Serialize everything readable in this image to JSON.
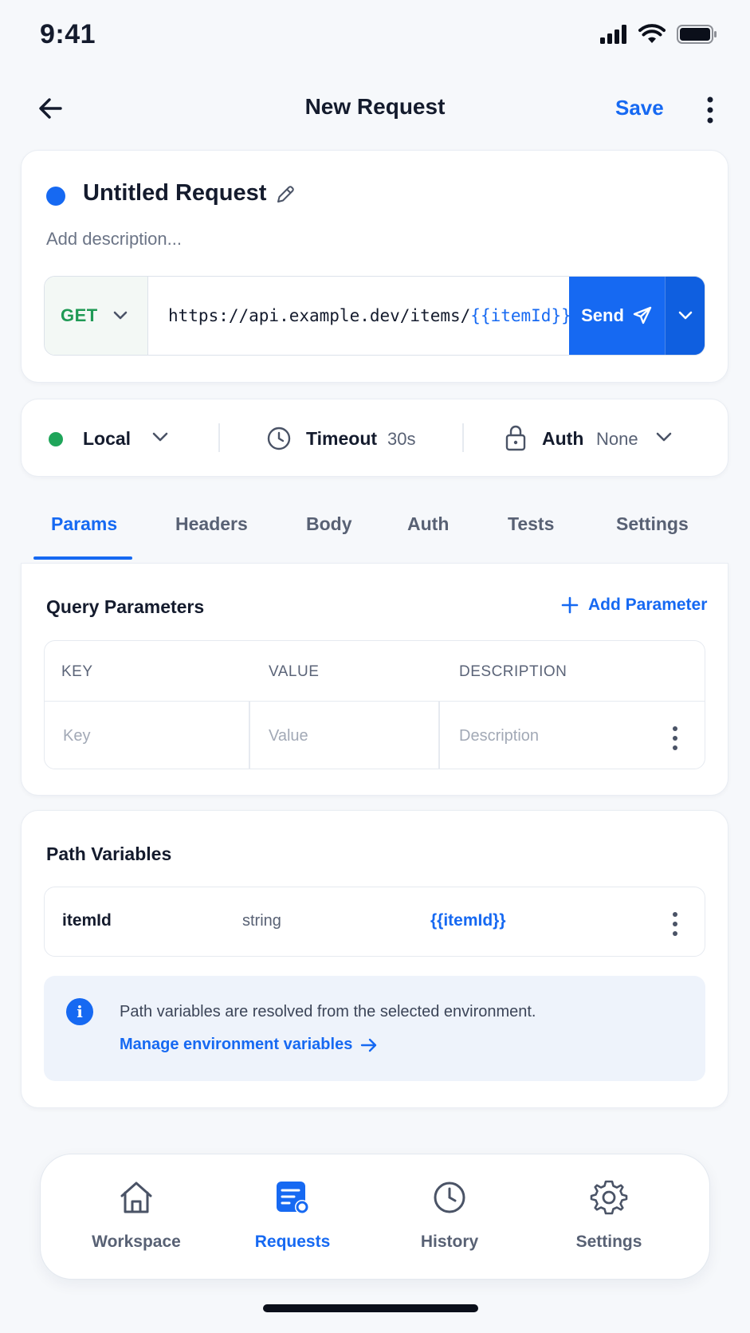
{
  "status_bar": {
    "time": "9:41"
  },
  "nav": {
    "title": "New Request",
    "save_label": "Save"
  },
  "request": {
    "name": "Untitled Request",
    "description_placeholder": "Add description...",
    "method": "GET",
    "url_base": "https://api.example.dev/items/",
    "url_variable": "{{itemId}}",
    "send_label": "Send"
  },
  "environment": {
    "name": "Local",
    "timeout_label": "Timeout",
    "timeout_value": "30s",
    "auth_label": "Auth",
    "auth_value": "None"
  },
  "tabs": [
    {
      "label": "Params",
      "active": true
    },
    {
      "label": "Headers",
      "active": false
    },
    {
      "label": "Body",
      "active": false
    },
    {
      "label": "Auth",
      "active": false
    },
    {
      "label": "Tests",
      "active": false
    },
    {
      "label": "Settings",
      "active": false
    }
  ],
  "query_params": {
    "title": "Query Parameters",
    "add_label": "Add Parameter",
    "columns": [
      "KEY",
      "VALUE",
      "DESCRIPTION"
    ],
    "placeholders": [
      "Key",
      "Value",
      "Description"
    ]
  },
  "path_variables": {
    "title": "Path Variables",
    "rows": [
      {
        "key": "itemId",
        "type": "string",
        "value": "{{itemId}}"
      }
    ],
    "info_text": "Path variables are resolved from the selected environment.",
    "info_link": "Manage environment variables"
  },
  "bottom_nav": [
    {
      "label": "Workspace",
      "icon": "home-icon",
      "active": false
    },
    {
      "label": "Requests",
      "icon": "requests-icon",
      "active": true
    },
    {
      "label": "History",
      "icon": "history-icon",
      "active": false
    },
    {
      "label": "Settings",
      "icon": "gear-icon",
      "active": false
    }
  ],
  "colors": {
    "accent": "#1669f2",
    "get_method": "#1f9a55",
    "env_dot": "#1fa55a"
  }
}
